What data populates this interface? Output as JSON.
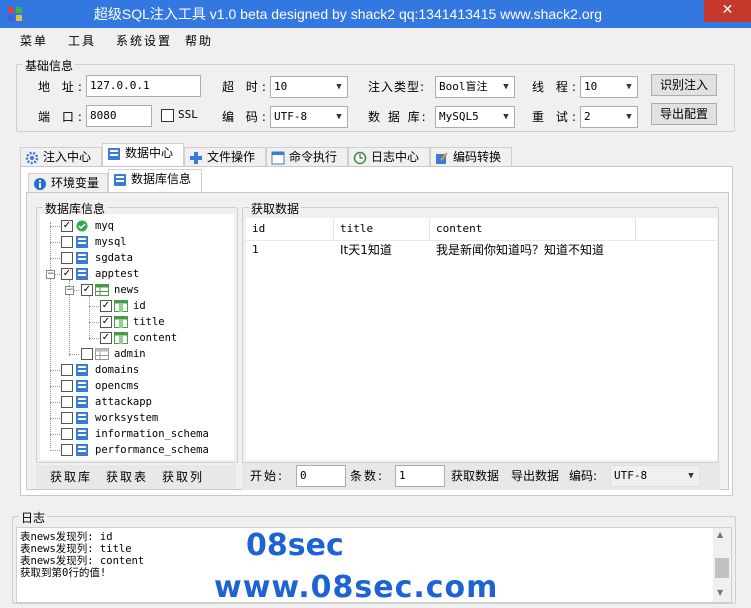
{
  "window": {
    "title": "超级SQL注入工具 v1.0 beta designed by shack2 qq:1341413415 www.shack2.org",
    "close_glyph": "✕"
  },
  "menu": [
    "菜单",
    "工具",
    "系统设置",
    "帮助"
  ],
  "basic_info": {
    "legend": "基础信息",
    "address_label": "地 址:",
    "address_value": "127.0.0.1",
    "port_label": "端 口:",
    "port_value": "8080",
    "ssl_label": "SSL",
    "timeout_label": "超 时:",
    "timeout_value": "10",
    "encoding_label": "编 码:",
    "encoding_value": "UTF-8",
    "inject_type_label": "注入类型:",
    "inject_type_value": "Bool盲注",
    "db_label": "数 据 库:",
    "db_value": "MySQL5",
    "threads_label": "线 程:",
    "threads_value": "10",
    "retry_label": "重 试:",
    "retry_value": "2",
    "identify_button": "识别注入",
    "export_button": "导出配置"
  },
  "main_tabs": [
    "注入中心",
    "数据中心",
    "文件操作",
    "命令执行",
    "日志中心",
    "编码转换"
  ],
  "sub_tabs": [
    "环境变量",
    "数据库信息"
  ],
  "db_info": {
    "legend": "数据库信息",
    "tree": [
      {
        "label": "myq"
      },
      {
        "label": "mysql"
      },
      {
        "label": "sgdata"
      },
      {
        "label": "apptest"
      },
      {
        "label": "news"
      },
      {
        "label": "id"
      },
      {
        "label": "title"
      },
      {
        "label": "content"
      },
      {
        "label": "admin"
      },
      {
        "label": "domains"
      },
      {
        "label": "opencms"
      },
      {
        "label": "attackapp"
      },
      {
        "label": "worksystem"
      },
      {
        "label": "information_schema"
      },
      {
        "label": "performance_schema"
      }
    ],
    "buttons": [
      "获取库",
      "获取表",
      "获取列"
    ]
  },
  "fetch_data": {
    "legend": "获取数据",
    "columns": [
      "id",
      "title",
      "content"
    ],
    "rows": [
      [
        "1",
        "It天1知道",
        "我是新闻你知道吗？知道不知道"
      ]
    ],
    "start_label": "开始:",
    "start_value": "0",
    "count_label": "条数:",
    "count_value": "1",
    "fetch_button": "获取数据",
    "export_button": "导出数据",
    "encoding_label": "编码:",
    "encoding_value": "UTF-8"
  },
  "log": {
    "legend": "日志",
    "lines": [
      "表news发现列: id",
      "表news发现列: title",
      "表news发现列: content",
      "获取到第0行的值!"
    ]
  },
  "watermark": {
    "line1": "08sec",
    "line2": "www.08sec.com"
  },
  "colors": {
    "titlebar": "#3377e0",
    "close": "#c7382c",
    "watermark": "#1d63d4"
  }
}
